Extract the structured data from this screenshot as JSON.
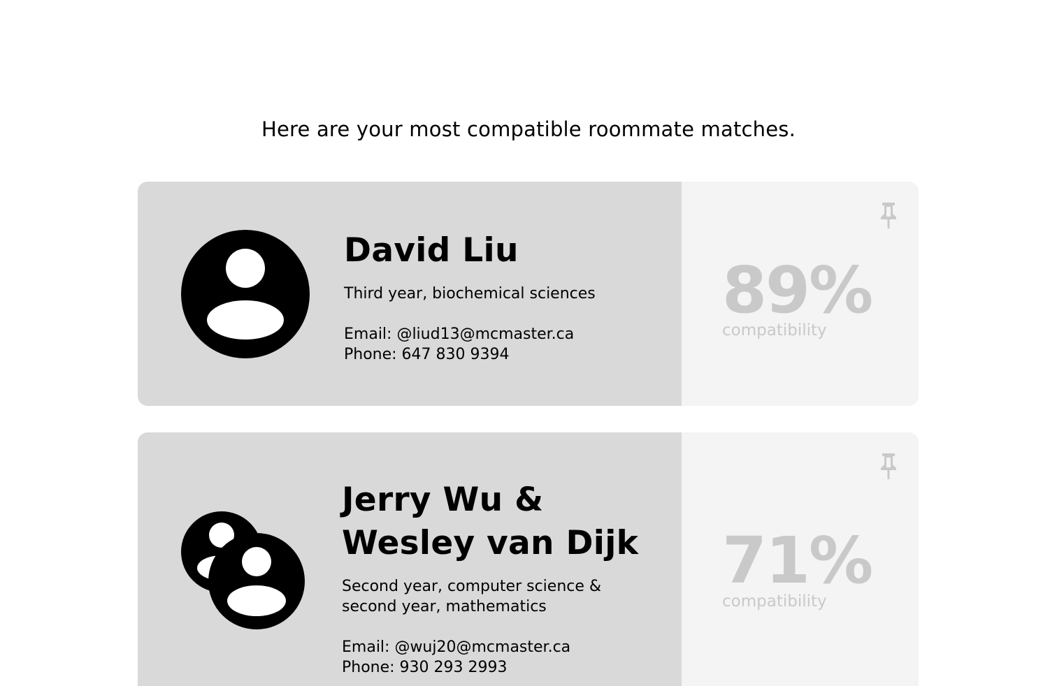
{
  "heading": "Here are your most compatible roommate matches.",
  "matches": [
    {
      "name_line1": "David Liu",
      "description_line1": "Third year, biochemical sciences",
      "email": "Email: @liud13@mcmaster.ca",
      "phone": "Phone: 647 830 9394",
      "compatibility": "89%",
      "compatibility_label": "compatibility",
      "avatar_icon": "user-avatar-icon",
      "pin_icon": "pin-icon"
    },
    {
      "name_line1": "Jerry Wu &",
      "name_line2": "Wesley van Dijk",
      "description_line1": "Second year, computer science &",
      "description_line2": "second year, mathematics",
      "email": "Email: @wuj20@mcmaster.ca",
      "phone": "Phone: 930 293 2993",
      "compatibility": "71%",
      "compatibility_label": "compatibility",
      "avatar_icon": "group-avatar-icon",
      "pin_icon": "pin-icon"
    }
  ],
  "colors": {
    "card_main_bg": "#d9d9d9",
    "card_side_bg": "#f4f4f4",
    "percent_text": "#c9c9c9",
    "text": "#000000"
  }
}
